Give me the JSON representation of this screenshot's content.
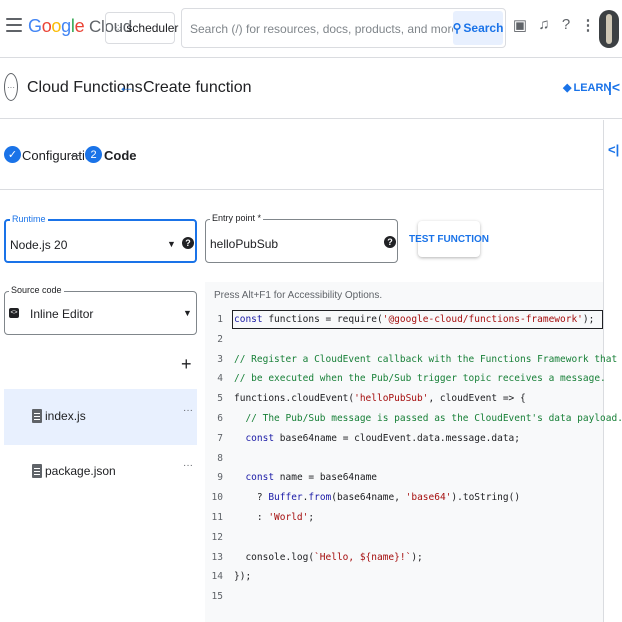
{
  "topbar": {
    "logo_google": "Google",
    "logo_cloud": "Cloud",
    "project": "scheduler",
    "search_placeholder": "Search (/) for resources, docs, products, and more",
    "search_button": "Search"
  },
  "secbar": {
    "product": "Cloud Functions",
    "page_title": "Create function",
    "learn": "LEARN"
  },
  "stepper": {
    "step1": "Configuration",
    "step2_num": "2",
    "step2": "Code"
  },
  "runtime": {
    "label": "Runtime",
    "value": "Node.js 20"
  },
  "entry_point": {
    "label": "Entry point *",
    "value": "helloPubSub"
  },
  "test_button": "TEST FUNCTION",
  "source_code": {
    "label": "Source code",
    "value": "Inline Editor"
  },
  "files": [
    {
      "name": "index.js"
    },
    {
      "name": "package.json"
    }
  ],
  "editor": {
    "hint": "Press Alt+F1 for Accessibility Options.",
    "lines": [
      {
        "n": "1",
        "html": "<span class=\"kw\">const</span> functions = require(<span class=\"str\">'@google-cloud/functions-framework'</span>);"
      },
      {
        "n": "2",
        "html": ""
      },
      {
        "n": "3",
        "html": "<span class=\"cm\">// Register a CloudEvent callback with the Functions Framework that will</span>"
      },
      {
        "n": "4",
        "html": "<span class=\"cm\">// be executed when the Pub/Sub trigger topic receives a message.</span>"
      },
      {
        "n": "5",
        "html": "functions.cloudEvent(<span class=\"str\">'helloPubSub'</span>, cloudEvent =&gt; {"
      },
      {
        "n": "6",
        "html": "  <span class=\"cm\">// The Pub/Sub message is passed as the CloudEvent's data payload.</span>"
      },
      {
        "n": "7",
        "html": "  <span class=\"kw\">const</span> base64name = cloudEvent.data.message.data;"
      },
      {
        "n": "8",
        "html": ""
      },
      {
        "n": "9",
        "html": "  <span class=\"kw\">const</span> name = base64name"
      },
      {
        "n": "10",
        "html": "    ? <span class=\"kw\">Buffer</span>.<span class=\"kw\">from</span>(base64name, <span class=\"str\">'base64'</span>).toString()"
      },
      {
        "n": "11",
        "html": "    : <span class=\"str\">'World'</span>;"
      },
      {
        "n": "12",
        "html": ""
      },
      {
        "n": "13",
        "html": "  console.log(<span class=\"str\">`Hello, ${name}!`</span>);"
      },
      {
        "n": "14",
        "html": "});"
      },
      {
        "n": "15",
        "html": ""
      }
    ]
  }
}
